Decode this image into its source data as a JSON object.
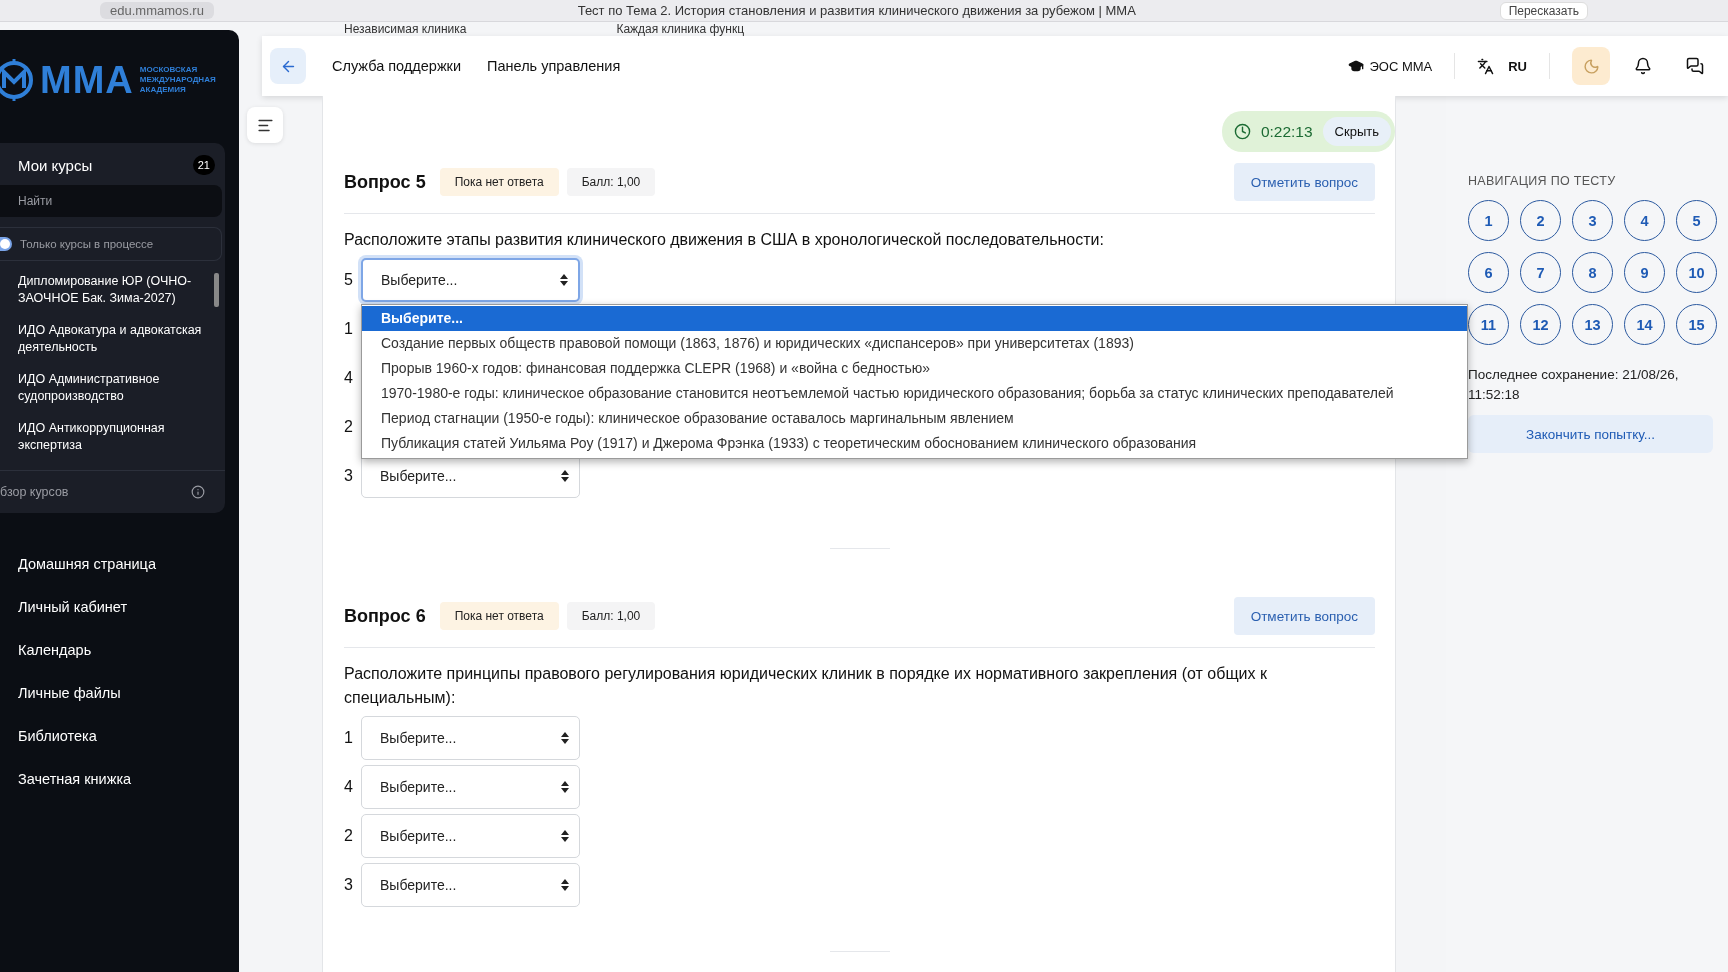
{
  "browser": {
    "address": "edu.mmamos.ru",
    "page_title": "Тест по Тема 2. История становления и развития клинического движения за рубежом | ММА",
    "retell_button": "Пересказать"
  },
  "behind_header": {
    "column_1": "Независимая клиника",
    "column_2": "Каждая клиника функц"
  },
  "sidebar": {
    "logo": {
      "mark": "ММА",
      "subtitle": "МОСКОВСКАЯ МЕЖДУНАРОДНАЯ АКАДЕМИЯ"
    },
    "courses_card": {
      "title": "Мои курсы",
      "count": "21",
      "search": {
        "placeholder": "Найти"
      },
      "filter": {
        "label": "Только курсы в процессе",
        "on": true
      },
      "courses": [
        "Дипломирование ЮР (ОЧНО-ЗАОЧНОЕ Бак. Зима-2027)",
        "ИДО Адвокатура и адвокатская деятельность",
        "ИДО Административное судопроизводство",
        "ИДО Антикоррупционная экспертиза"
      ],
      "footer": "бзор курсов"
    },
    "nav_items": [
      "Домашняя страница",
      "Личный кабинет",
      "Календарь",
      "Личные файлы",
      "Библиотека",
      "Зачетная книжка"
    ]
  },
  "header": {
    "links": [
      "Служба поддержки",
      "Панель управления"
    ],
    "portal": "ЭОС ММА",
    "language": "RU"
  },
  "timer": {
    "time": "0:22:13",
    "hide_button": "Скрыть"
  },
  "questions": [
    {
      "title": "Вопрос 5",
      "status": "Пока нет ответа",
      "grade": "Балл: 1,00",
      "flag_button": "Отметить вопрос",
      "text": "Расположите этапы развития клинического движения в США в хронологической последовательности:",
      "rows": [
        {
          "number": "5",
          "value": "Выберите...",
          "focused": true,
          "options": [
            {
              "label": "Выберите...",
              "selected": true
            },
            {
              "label": "Создание первых обществ правовой помощи (1863, 1876) и юридических «диспансеров» при университетах (1893)",
              "selected": false
            },
            {
              "label": "Прорыв 1960-х годов: финансовая поддержка CLEPR (1968) и «война с бедностью»",
              "selected": false
            },
            {
              "label": "1970-1980-е годы: клиническое образование становится неотъемлемой частью юридического образования; борьба за статус клинических преподавателей",
              "selected": false
            },
            {
              "label": "Период стагнации (1950-е годы): клиническое образование оставалось маргинальным явлением",
              "selected": false
            },
            {
              "label": "Публикация статей Уильяма Роу (1917) и Джерома Фрэнка (1933) с теоретическим обоснованием клинического образования",
              "selected": false
            }
          ]
        },
        {
          "number": "1"
        },
        {
          "number": "4"
        },
        {
          "number": "2"
        },
        {
          "number": "3",
          "value": "Выберите...",
          "focused": false
        }
      ]
    },
    {
      "title": "Вопрос 6",
      "status": "Пока нет ответа",
      "grade": "Балл: 1,00",
      "flag_button": "Отметить вопрос",
      "text": "Расположите принципы правового регулирования юридических клиник в порядке их нормативного закрепления (от общих к специальным):",
      "rows": [
        {
          "number": "1",
          "value": "Выберите...",
          "focused": false
        },
        {
          "number": "4",
          "value": "Выберите...",
          "focused": false
        },
        {
          "number": "2",
          "value": "Выберите...",
          "focused": false
        },
        {
          "number": "3",
          "value": "Выберите...",
          "focused": false
        }
      ]
    }
  ],
  "navigation": {
    "title": "НАВИГАЦИЯ ПО ТЕСТУ",
    "buttons": [
      "1",
      "2",
      "3",
      "4",
      "5",
      "6",
      "7",
      "8",
      "9",
      "10",
      "11",
      "12",
      "13",
      "14",
      "15"
    ],
    "last_saved": "Последнее сохранение: 21/08/26, 11:52:18",
    "finish_button": "Закончить попытку..."
  }
}
